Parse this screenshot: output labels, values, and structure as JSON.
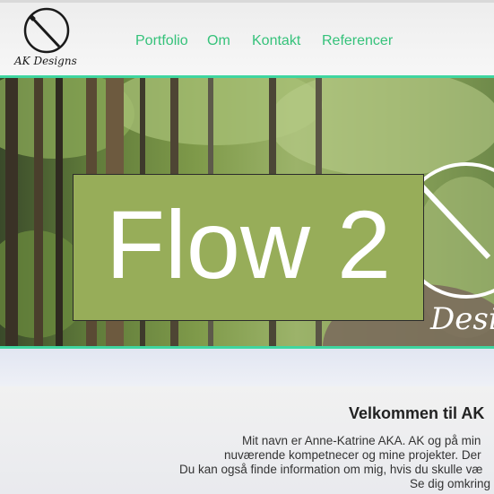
{
  "brand": {
    "logo_text": "AK Designs"
  },
  "nav": {
    "items": [
      {
        "label": "Portfolio"
      },
      {
        "label": "Om"
      },
      {
        "label": "Kontakt"
      },
      {
        "label": "Referencer"
      }
    ]
  },
  "hero": {
    "overlay_label": "Flow 2",
    "watermark_text": "Desig"
  },
  "welcome": {
    "heading": "Velkommen til AK",
    "lines": [
      "Mit navn er Anne-Katrine AKA. AK og på min",
      "nuværende kompetnecer og mine projekter. Der",
      "Du kan også finde information om mig, hvis du skulle væ",
      "Se dig omkring"
    ]
  },
  "colors": {
    "accent": "#35c27a",
    "hero_border": "#3fd6a0",
    "overlay_box": "#97ad59"
  }
}
